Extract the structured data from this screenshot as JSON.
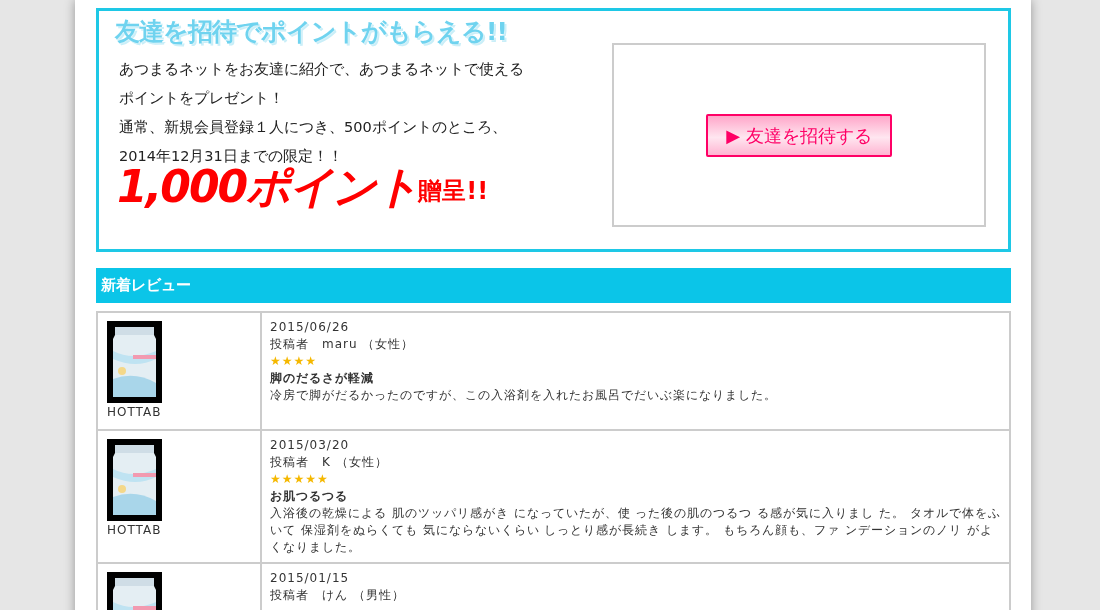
{
  "invite": {
    "title": "友達を招待でポイントがもらえる!!",
    "description": [
      "あつまるネットをお友達に紹介で、あつまるネットで使える",
      "ポイントをプレゼント！",
      "通常、新規会員登録１人につき、500ポイントのところ、",
      "2014年12月31日までの限定！！"
    ],
    "amount": "1,000ポイント",
    "amount_suffix": "贈呈!!",
    "button": "▶ 友達を招待する"
  },
  "reviews_header": "新着レビュー",
  "reviews": [
    {
      "product": {
        "kind": "picture",
        "name": "HOTTAB"
      },
      "date": "2015/06/26",
      "author": "投稿者　maru （女性）",
      "stars": 4,
      "title": "脚のだるさが軽減",
      "body": "冷房で脚がだるかったのですが、この入浴剤を入れたお風呂でだいぶ楽になりました。"
    },
    {
      "product": {
        "kind": "picture",
        "name": "HOTTAB"
      },
      "date": "2015/03/20",
      "author": "投稿者　K （女性）",
      "stars": 5,
      "title": "お肌つるつる",
      "body": "入浴後の乾燥による 肌のツッパリ感がき になっていたが、使 った後の肌のつるつ る感が気に入りまし た。 タオルで体をふいて 保湿剤をぬらくても 気にならないくらい しっとり感が長続き します。 もちろん顔も、ファ ンデーションのノリ がよくなりました。"
    },
    {
      "date": "2015/01/15",
      "author": "投稿者　けん （男性）"
    }
  ]
}
